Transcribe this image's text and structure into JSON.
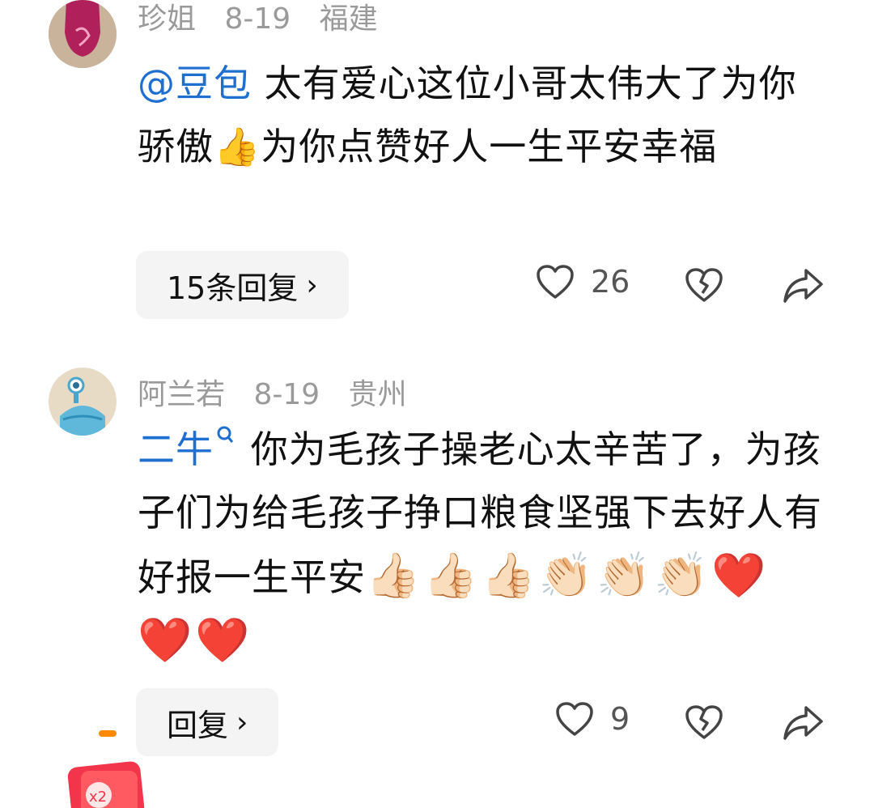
{
  "comments": [
    {
      "user": "珍姐",
      "date": "8-19",
      "location": "福建",
      "mention": "@豆包",
      "text": " 太有爱心这位小哥太伟大了为你骄傲👍为你点赞好人一生平安幸福",
      "reply_label": "15条回复",
      "likes": "26",
      "avatar_icon": "red-cartoon-avatar-icon"
    },
    {
      "user": "阿兰若",
      "date": "8-19",
      "location": "贵州",
      "mention": "二牛",
      "text": " 你为毛孩子操老心太辛苦了，为孩子们为给毛孩子挣口粮食坚强下去好人有好报一生平安",
      "emojis": "👍🏻👍🏻👍🏻👏🏻👏🏻👏🏻❤️❤️❤️",
      "reply_label": "回复",
      "likes": "9",
      "avatar_icon": "alien-avatar-icon"
    }
  ],
  "colors": {
    "mention": "#1f6fd1",
    "meta": "#9a9a9a",
    "button_bg": "#f4f4f4"
  }
}
